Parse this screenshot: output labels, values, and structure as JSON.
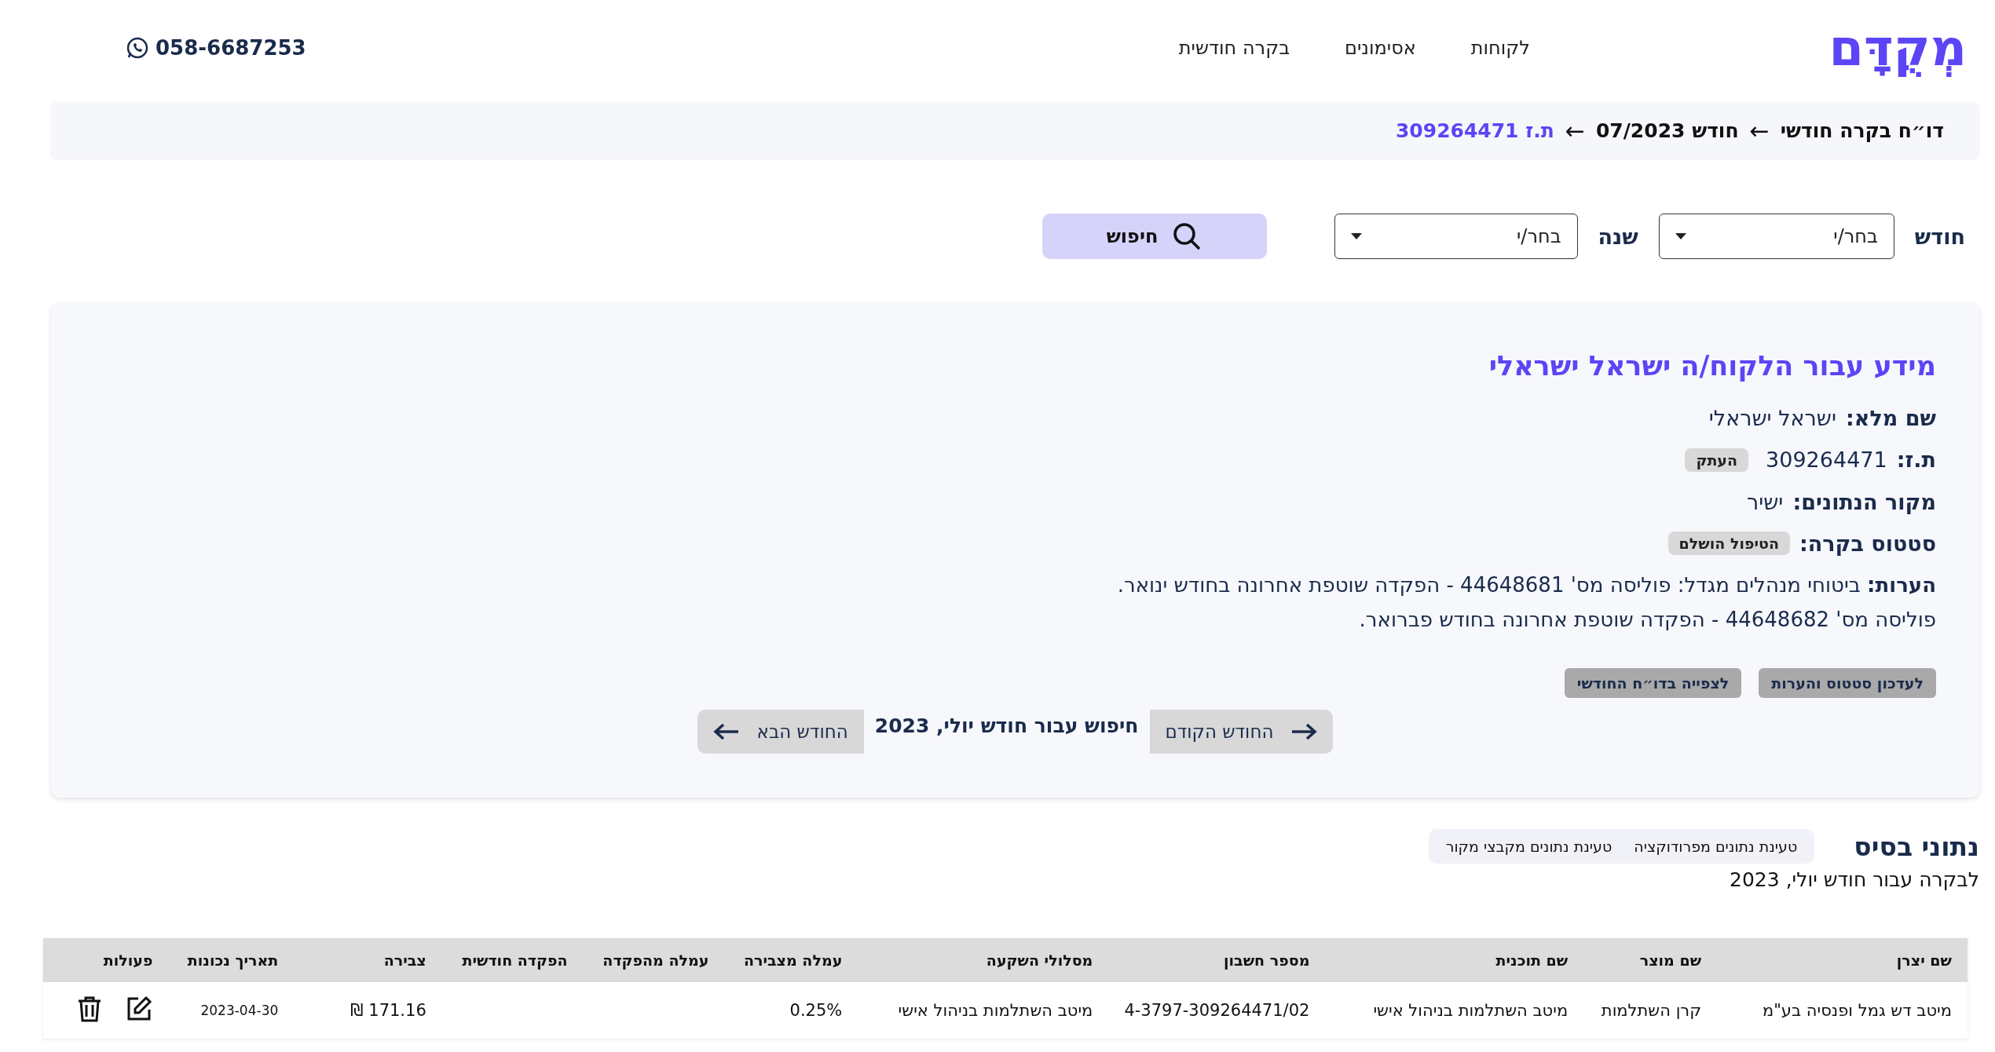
{
  "header": {
    "logo": "מְקֻדָּם",
    "nav": [
      {
        "label": "לקוחות",
        "selected": false
      },
      {
        "label": "אסימונים",
        "selected": false
      },
      {
        "label": "בקרה חודשית",
        "selected": false
      }
    ],
    "phone": "058-6687253"
  },
  "breadcrumb": {
    "separator": "←",
    "items": [
      {
        "label": "דו״ח בקרה חודשי",
        "current": false
      },
      {
        "label": "חודש 07/2023",
        "current": false
      },
      {
        "label": "ת.ז 309264471",
        "current": true
      }
    ]
  },
  "filters": {
    "month": {
      "label": "חודש",
      "placeholder": "בחר/י"
    },
    "year": {
      "label": "שנה",
      "placeholder": "בחר/י"
    },
    "search_button": "חיפוש"
  },
  "client_card": {
    "title": "מידע עבור הלקוח/ה ישראל ישראלי",
    "fields": [
      {
        "kind": "text",
        "label": "שם מלא:",
        "value": "ישראל ישראלי"
      },
      {
        "kind": "copy",
        "label": "ת.ז:",
        "value": "309264471",
        "action": "העתק"
      },
      {
        "kind": "text",
        "label": "מקור הנתונים:",
        "value": "ישיר"
      },
      {
        "kind": "badge",
        "label": "סטטוס בקרה:",
        "value": "הטיפול הושלם"
      }
    ],
    "notes": "**הערות:** ביטוחי מנהלים מגדל: פוליסה מס' 44648681 - הפקדה שוטפת אחרונה בחודש ינואר. פוליסה מס' 44648682 - הפקדה שוטפת אחרונה בחודש פברואר.",
    "actions": [
      "לעדכון סטטוס והערות",
      "לצפייה בדו״ח החודשי"
    ],
    "month_nav": {
      "previous": "החודש הקודם",
      "current": "חיפוש עבור חודש יולי, 2023",
      "next": "החודש הבא"
    }
  },
  "base_data": {
    "title": "נתוני בסיס",
    "subtitle": "לבקרה עבור חודש יולי, 2023",
    "load_buttons": [
      "טעינת נתונים מפרודוקציה",
      "טעינת נתונים מקבצי מקור"
    ],
    "table": {
      "columns": [
        "שם יצרן",
        "שם מוצר",
        "שם תוכנית",
        "מספר חשבון",
        "מסלולי השקעה",
        "עמלה מצבירה",
        "עמלה מהפקדה",
        "הפקדה חודשית",
        "צבירה",
        "תאריך נכונות",
        "פעולות"
      ],
      "rows": [
        [
          "מיטב דש גמל ופנסיה בע\"מ",
          "קרן השתלמות",
          "מיטב השתלמות בניהול אישי",
          "4-3797-309264471/02",
          "מיטב השתלמות בניהול אישי",
          "0.25%",
          "",
          "",
          "171.16 ₪",
          "2023-04-30"
        ]
      ]
    }
  }
}
